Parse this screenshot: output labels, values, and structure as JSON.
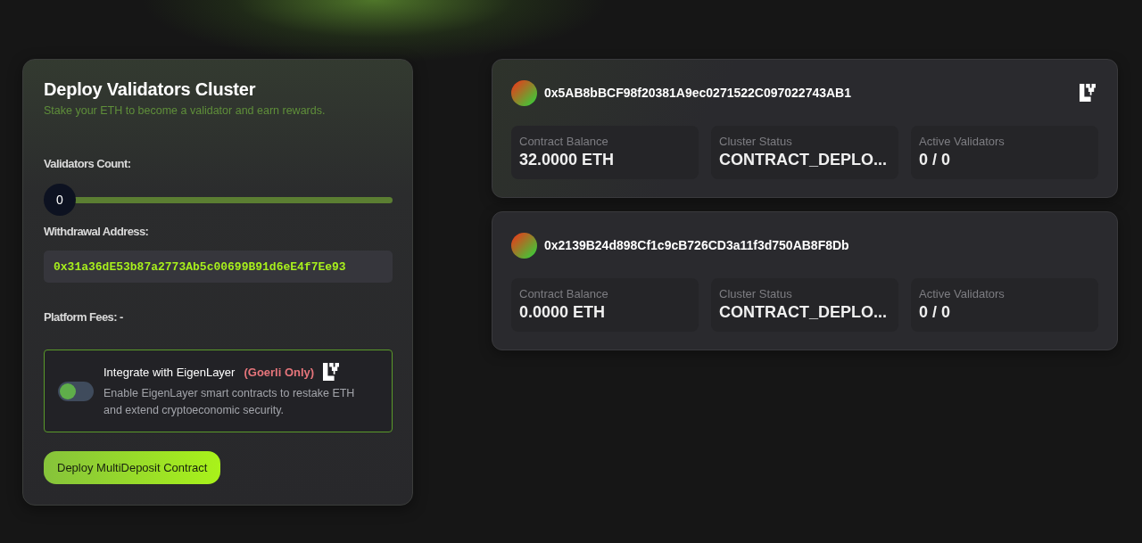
{
  "deploy_panel": {
    "title": "Deploy Validators Cluster",
    "subtitle": "Stake your ETH to become a validator and earn rewards.",
    "validators_count": {
      "label": "Validators Count:",
      "value": "0",
      "level": 0
    },
    "withdrawal_address": {
      "label": "Withdrawal Address:",
      "value": "0x31a36dE53b87a2773Ab5c00699B91d6eE4f7Ee93"
    },
    "platform_fees": "Platform Fees: -",
    "eigenlayer": {
      "title": "Integrate with EigenLayer",
      "note": "(Goerli Only)",
      "description": "Enable EigenLayer smart contracts to restake ETH and extend cryptoeconomic security.",
      "checked": false
    },
    "deploy_button": "Deploy MultiDeposit Contract"
  },
  "clusters": [
    {
      "address": "0x5AB8bBCF98f20381A9ec0271522C097022743AB1",
      "stats": [
        {
          "label": "Contract Balance",
          "value": "32.0000 ETH"
        },
        {
          "label": "Cluster Status",
          "value": "CONTRACT_DEPLO..."
        },
        {
          "label": "Active Validators",
          "value": "0 / 0"
        }
      ]
    },
    {
      "address": "0x2139B24d898Cf1c9cB726CD3a11f3d750AB8F8Db",
      "stats": [
        {
          "label": "Contract Balance",
          "value": "0.0000 ETH"
        },
        {
          "label": "Cluster Status",
          "value": "CONTRACT_DEPLO..."
        },
        {
          "label": "Active Validators",
          "value": "0 / 0"
        }
      ]
    }
  ]
}
